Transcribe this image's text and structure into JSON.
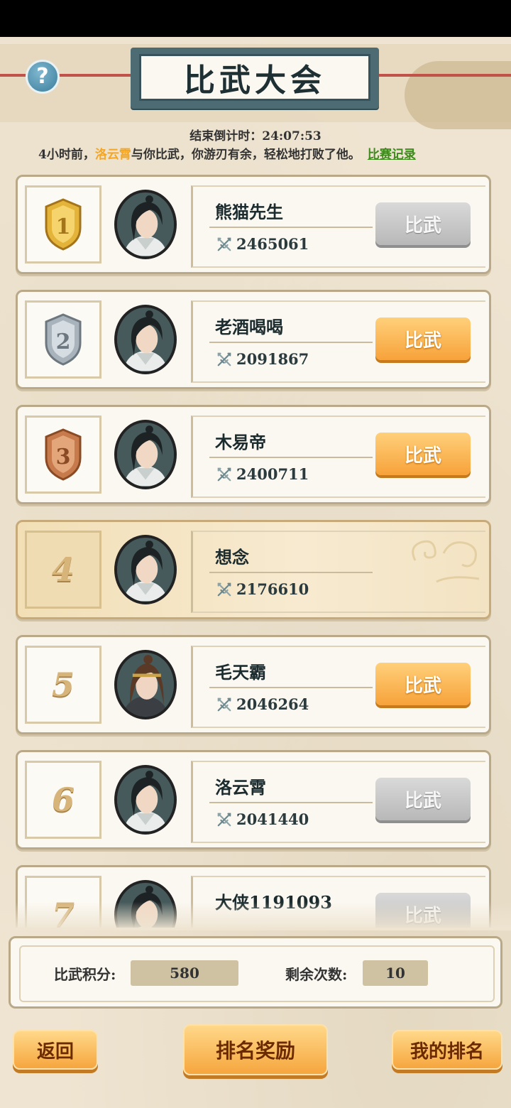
{
  "header": {
    "title": "比武大会",
    "countdown_label": "结束倒计时：",
    "countdown_value": "24:07:53",
    "news_prefix": "4小时前，",
    "news_highlight": "洛云霄",
    "news_suffix": "与你比武，你游刃有余，轻松地打败了他。",
    "record_link": "比赛记录"
  },
  "rankings": [
    {
      "rank": "1",
      "medal": "gold",
      "name": "熊猫先生",
      "power": "2465061",
      "button": "比武",
      "button_state": "disabled"
    },
    {
      "rank": "2",
      "medal": "silver",
      "name": "老酒喝喝",
      "power": "2091867",
      "button": "比武",
      "button_state": "active"
    },
    {
      "rank": "3",
      "medal": "bronze",
      "name": "木易帝",
      "power": "2400711",
      "button": "比武",
      "button_state": "active"
    },
    {
      "rank": "4",
      "medal": "none",
      "name": "想念",
      "power": "2176610",
      "button": "",
      "button_state": "self"
    },
    {
      "rank": "5",
      "medal": "none",
      "name": "毛天霸",
      "power": "2046264",
      "button": "比武",
      "button_state": "active"
    },
    {
      "rank": "6",
      "medal": "none",
      "name": "洛云霄",
      "power": "2041440",
      "button": "比武",
      "button_state": "disabled"
    },
    {
      "rank": "7",
      "medal": "none",
      "name": "大侠1191093",
      "power": "",
      "button": "比武",
      "button_state": "disabled"
    }
  ],
  "footer": {
    "score_label": "比武积分:",
    "score_value": "580",
    "remaining_label": "剩余次数:",
    "remaining_value": "10",
    "back_button": "返回",
    "reward_button": "排名奖励",
    "my_rank_button": "我的排名"
  },
  "colors": {
    "accent_orange": "#f7a23a",
    "highlight_name": "#f5a623",
    "link_green": "#3f8a1c",
    "title_frame": "#4c6b72"
  },
  "icons": {
    "help": "question-icon",
    "power": "crossed-swords-icon"
  }
}
